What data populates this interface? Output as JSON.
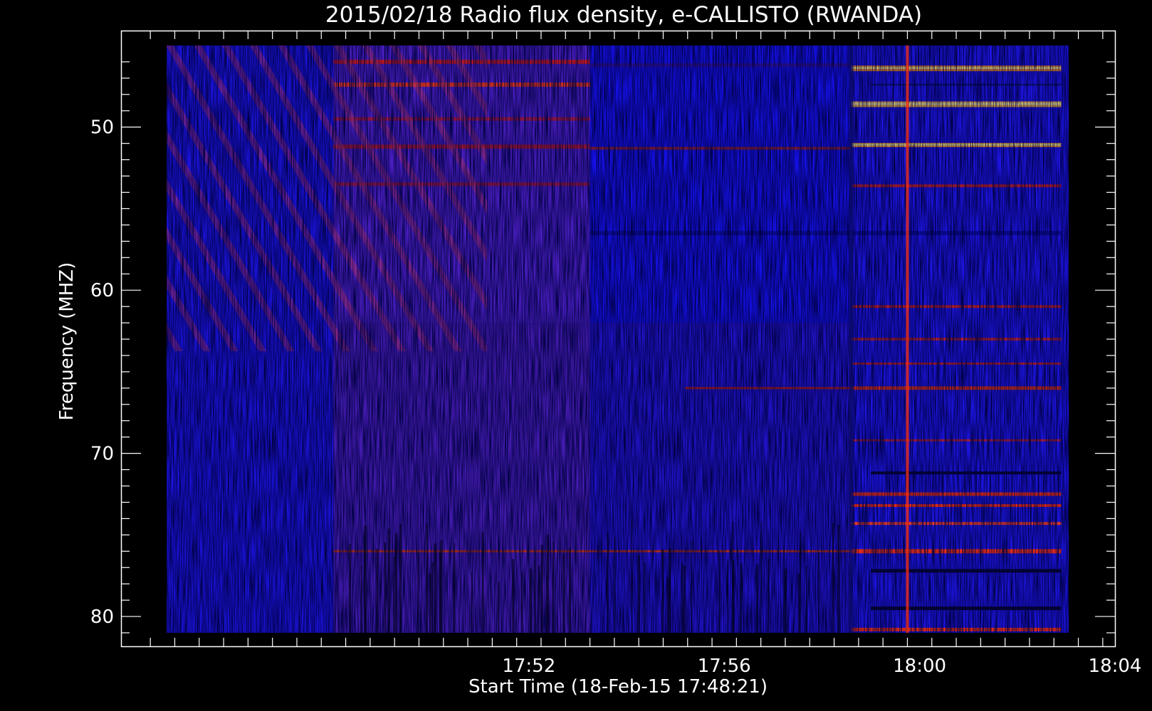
{
  "chart_data": {
    "type": "heatmap",
    "title": "2015/02/18  Radio flux density, e-CALLISTO (RWANDA)",
    "xlabel": "Start Time (18-Feb-15 17:48:21)",
    "ylabel": "Frequency (MHZ)",
    "x_start": "17:48:21",
    "x_end": "18:04:00",
    "xlim_minutes": [
      -4.35,
      16.0
    ],
    "x_ticks": [
      {
        "minutes": 4,
        "label": "17:52"
      },
      {
        "minutes": 8,
        "label": "17:56"
      },
      {
        "minutes": 12,
        "label": "18:00"
      },
      {
        "minutes": 16,
        "label": "18:04"
      }
    ],
    "ylim": [
      45,
      81
    ],
    "y_inverted": true,
    "y_ticks": [
      50,
      60,
      70,
      80
    ],
    "data_extent": {
      "minutes": [
        0.0,
        14.9
      ],
      "freq_mhz": [
        45,
        81
      ]
    },
    "colormap": [
      "#000000",
      "#0000ff",
      "#7a2a80",
      "#ff2000",
      "#ffff80"
    ],
    "features": [
      {
        "name": "diagonal drift stripes",
        "minutes": [
          0.0,
          5.25
        ],
        "freq_mhz": [
          45,
          66
        ]
      },
      {
        "name": "burst vertical line",
        "minute": 11.75
      },
      {
        "name": "post-burst bright bands",
        "minutes": [
          10.6,
          14.9
        ],
        "freq_mhz": [
          46.4,
          48.6,
          51.1,
          66.0,
          72.5,
          73.2,
          74.3,
          76.0,
          80.8
        ]
      }
    ]
  }
}
